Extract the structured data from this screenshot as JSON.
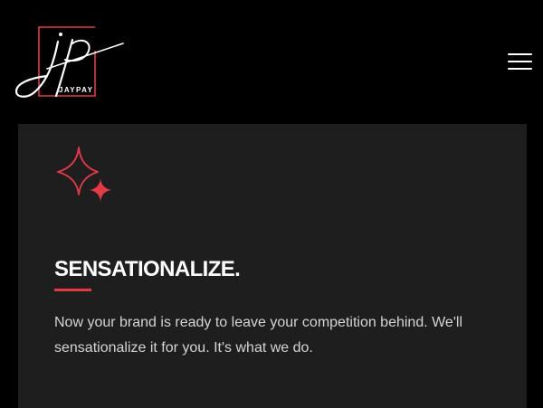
{
  "header": {
    "logo": {
      "monogram": "jp",
      "wordmark": "JAYPAY",
      "icon": "jp-signature-logo"
    },
    "menu": {
      "icon": "hamburger-menu-icon"
    }
  },
  "card": {
    "icon": "sparkle-icon",
    "title": "SENSATIONALIZE.",
    "body": "Now your brand is ready to leave your competition behind. We'll sensationalize it for you. It's what we do."
  },
  "colors": {
    "background": "#000000",
    "card": "#1e1e1f",
    "accent": "#e63946",
    "text": "#ffffff",
    "body_text": "#d4d4d4"
  }
}
